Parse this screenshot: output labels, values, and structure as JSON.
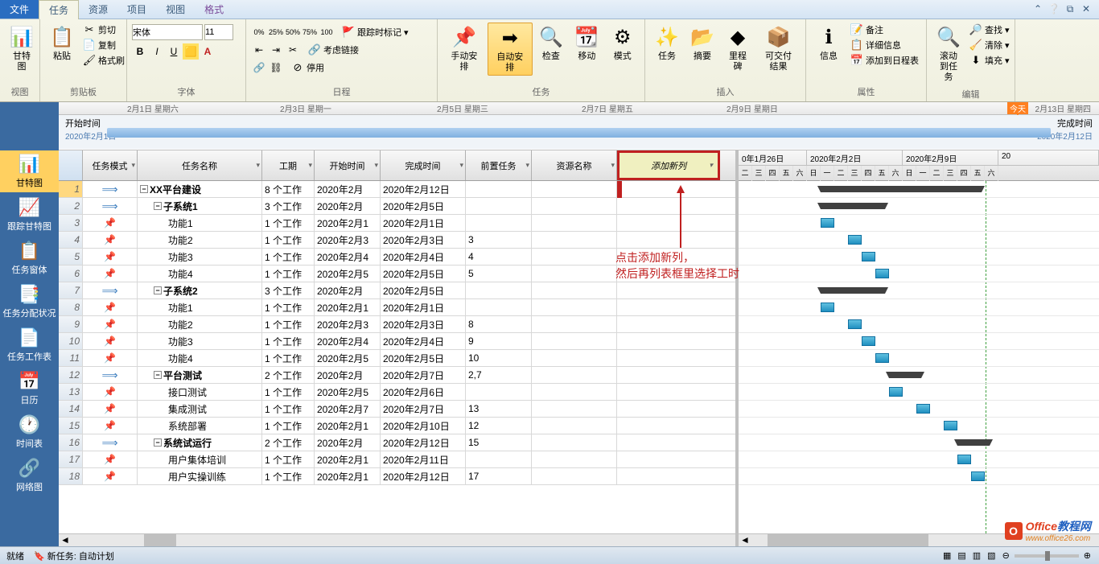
{
  "menu": {
    "file": "文件",
    "tabs": [
      "任务",
      "资源",
      "项目",
      "视图"
    ],
    "format": "格式",
    "active": "任务"
  },
  "ribbon": {
    "view": {
      "gantt": "甘特图",
      "label": "视图"
    },
    "clipboard": {
      "paste": "粘贴",
      "cut": "剪切",
      "copy": "复制",
      "format_painter": "格式刷",
      "label": "剪贴板"
    },
    "font": {
      "name": "宋体",
      "size": "11",
      "label": "字体"
    },
    "schedule": {
      "track": "跟踪时标记",
      "link": "考虑链接",
      "disable": "停用",
      "label": "日程"
    },
    "tasks": {
      "manual": "手动安排",
      "auto": "自动安排",
      "inspect": "检查",
      "move": "移动",
      "mode": "模式",
      "label": "任务"
    },
    "insert": {
      "task": "任务",
      "summary": "摘要",
      "milestone": "里程碑",
      "deliverable": "可交付结果",
      "label": "插入"
    },
    "properties": {
      "info": "信息",
      "notes": "备注",
      "details": "详细信息",
      "timeline": "添加到日程表",
      "label": "属性"
    },
    "edit": {
      "scroll": "滚动到任务",
      "find": "查找",
      "clear": "清除",
      "fill": "填充",
      "label": "编辑"
    }
  },
  "timeline": {
    "dates": [
      "2月1日  星期六",
      "2月3日  星期一",
      "2月5日  星期三",
      "2月7日  星期五",
      "2月9日  星期日",
      "2月13日  星期四"
    ],
    "today": "今天",
    "start_label": "开始时间",
    "start_date": "2020年2月1日",
    "end_label": "完成时间",
    "end_date": "2020年2月12日"
  },
  "sidebar": {
    "items": [
      {
        "label": "甘特图",
        "icon": "📊"
      },
      {
        "label": "跟踪甘特图",
        "icon": "📈"
      },
      {
        "label": "任务窗体",
        "icon": "📋"
      },
      {
        "label": "任务分配状况",
        "icon": "📑"
      },
      {
        "label": "任务工作表",
        "icon": "📄"
      },
      {
        "label": "日历",
        "icon": "📅"
      },
      {
        "label": "时间表",
        "icon": "🕐"
      },
      {
        "label": "网络图",
        "icon": "🔗"
      }
    ]
  },
  "grid": {
    "headers": {
      "mode": "任务模式",
      "name": "任务名称",
      "duration": "工期",
      "start": "开始时间",
      "end": "完成时间",
      "pred": "前置任务",
      "resource": "资源名称",
      "new": "添加新列"
    },
    "rows": [
      {
        "n": 1,
        "mode": "auto",
        "indent": 0,
        "name": "XX平台建设",
        "dur": "8 个工作",
        "start": "2020年2月",
        "end": "2020年2月12日",
        "pred": "",
        "out": true
      },
      {
        "n": 2,
        "mode": "auto",
        "indent": 1,
        "name": "子系统1",
        "dur": "3 个工作",
        "start": "2020年2月",
        "end": "2020年2月5日",
        "pred": "",
        "out": true
      },
      {
        "n": 3,
        "mode": "pin",
        "indent": 2,
        "name": "功能1",
        "dur": "1 个工作",
        "start": "2020年2月1",
        "end": "2020年2月1日",
        "pred": ""
      },
      {
        "n": 4,
        "mode": "pin",
        "indent": 2,
        "name": "功能2",
        "dur": "1 个工作",
        "start": "2020年2月3",
        "end": "2020年2月3日",
        "pred": "3"
      },
      {
        "n": 5,
        "mode": "pin",
        "indent": 2,
        "name": "功能3",
        "dur": "1 个工作",
        "start": "2020年2月4",
        "end": "2020年2月4日",
        "pred": "4"
      },
      {
        "n": 6,
        "mode": "pin",
        "indent": 2,
        "name": "功能4",
        "dur": "1 个工作",
        "start": "2020年2月5",
        "end": "2020年2月5日",
        "pred": "5"
      },
      {
        "n": 7,
        "mode": "auto",
        "indent": 1,
        "name": "子系统2",
        "dur": "3 个工作",
        "start": "2020年2月",
        "end": "2020年2月5日",
        "pred": "",
        "out": true
      },
      {
        "n": 8,
        "mode": "pin",
        "indent": 2,
        "name": "功能1",
        "dur": "1 个工作",
        "start": "2020年2月1",
        "end": "2020年2月1日",
        "pred": ""
      },
      {
        "n": 9,
        "mode": "pin",
        "indent": 2,
        "name": "功能2",
        "dur": "1 个工作",
        "start": "2020年2月3",
        "end": "2020年2月3日",
        "pred": "8"
      },
      {
        "n": 10,
        "mode": "pin",
        "indent": 2,
        "name": "功能3",
        "dur": "1 个工作",
        "start": "2020年2月4",
        "end": "2020年2月4日",
        "pred": "9"
      },
      {
        "n": 11,
        "mode": "pin",
        "indent": 2,
        "name": "功能4",
        "dur": "1 个工作",
        "start": "2020年2月5",
        "end": "2020年2月5日",
        "pred": "10"
      },
      {
        "n": 12,
        "mode": "auto",
        "indent": 1,
        "name": "平台测试",
        "dur": "2 个工作",
        "start": "2020年2月",
        "end": "2020年2月7日",
        "pred": "2,7",
        "out": true
      },
      {
        "n": 13,
        "mode": "pin",
        "indent": 2,
        "name": "接口测试",
        "dur": "1 个工作",
        "start": "2020年2月5",
        "end": "2020年2月6日",
        "pred": ""
      },
      {
        "n": 14,
        "mode": "pin",
        "indent": 2,
        "name": "集成测试",
        "dur": "1 个工作",
        "start": "2020年2月7",
        "end": "2020年2月7日",
        "pred": "13"
      },
      {
        "n": 15,
        "mode": "pin",
        "indent": 2,
        "name": "系统部署",
        "dur": "1 个工作",
        "start": "2020年2月1",
        "end": "2020年2月10日",
        "pred": "12"
      },
      {
        "n": 16,
        "mode": "auto",
        "indent": 1,
        "name": "系统试运行",
        "dur": "2 个工作",
        "start": "2020年2月",
        "end": "2020年2月12日",
        "pred": "15",
        "out": true
      },
      {
        "n": 17,
        "mode": "pin",
        "indent": 2,
        "name": "用户集体培训",
        "dur": "1 个工作",
        "start": "2020年2月1",
        "end": "2020年2月11日",
        "pred": ""
      },
      {
        "n": 18,
        "mode": "pin",
        "indent": 2,
        "name": "用户实操训练",
        "dur": "1 个工作",
        "start": "2020年2月1",
        "end": "2020年2月12日",
        "pred": "17"
      }
    ]
  },
  "gantt_header": {
    "weeks": [
      "0年1月26日",
      "2020年2月2日",
      "2020年2月9日",
      "20"
    ],
    "days": "日一二三四五六"
  },
  "annotation": {
    "line1": "点击添加新列，",
    "line2": "然后再列表框里选择工时"
  },
  "statusbar": {
    "ready": "就绪",
    "newtask": "新任务: 自动计划"
  },
  "watermark": {
    "t1": "Office",
    "t2": "教程网",
    "url": "www.office26.com"
  }
}
